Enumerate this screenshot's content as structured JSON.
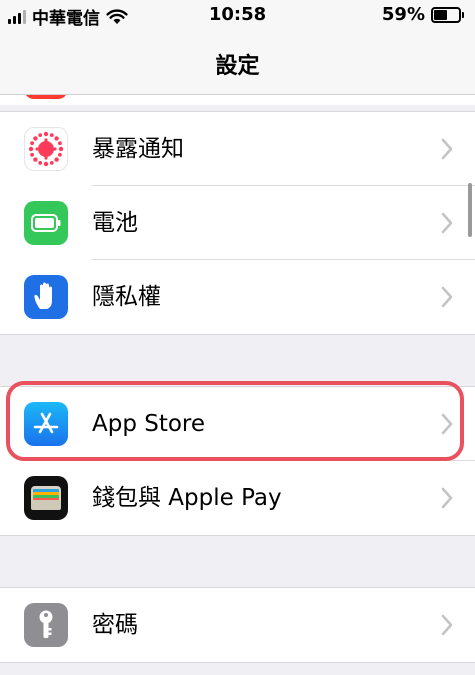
{
  "status_bar": {
    "carrier": "中華電信",
    "time": "10:58",
    "battery_percent": "59%",
    "battery_level": 0.59,
    "icons": [
      "signal-icon",
      "wifi-icon",
      "battery-icon"
    ]
  },
  "nav": {
    "title": "設定"
  },
  "groups": [
    {
      "rows": [
        {
          "label": "暴露通知",
          "icon": "exposure-notification-icon",
          "icon_color": "#ffffff"
        },
        {
          "label": "電池",
          "icon": "battery-settings-icon",
          "icon_color": "#34c759"
        },
        {
          "label": "隱私權",
          "icon": "privacy-hand-icon",
          "icon_color": "#1f6fe5"
        }
      ]
    },
    {
      "rows": [
        {
          "label": "App Store",
          "icon": "app-store-icon",
          "icon_color": "#1a8cf3"
        },
        {
          "label": "錢包與 Apple Pay",
          "icon": "wallet-icon",
          "icon_color": "#111111"
        }
      ]
    },
    {
      "rows": [
        {
          "label": "密碼",
          "icon": "key-icon",
          "icon_color": "#8e8e93"
        }
      ]
    }
  ],
  "colors": {
    "highlight": "#e8515d",
    "background": "#efeff4",
    "chevron": "#c4c4c7"
  }
}
